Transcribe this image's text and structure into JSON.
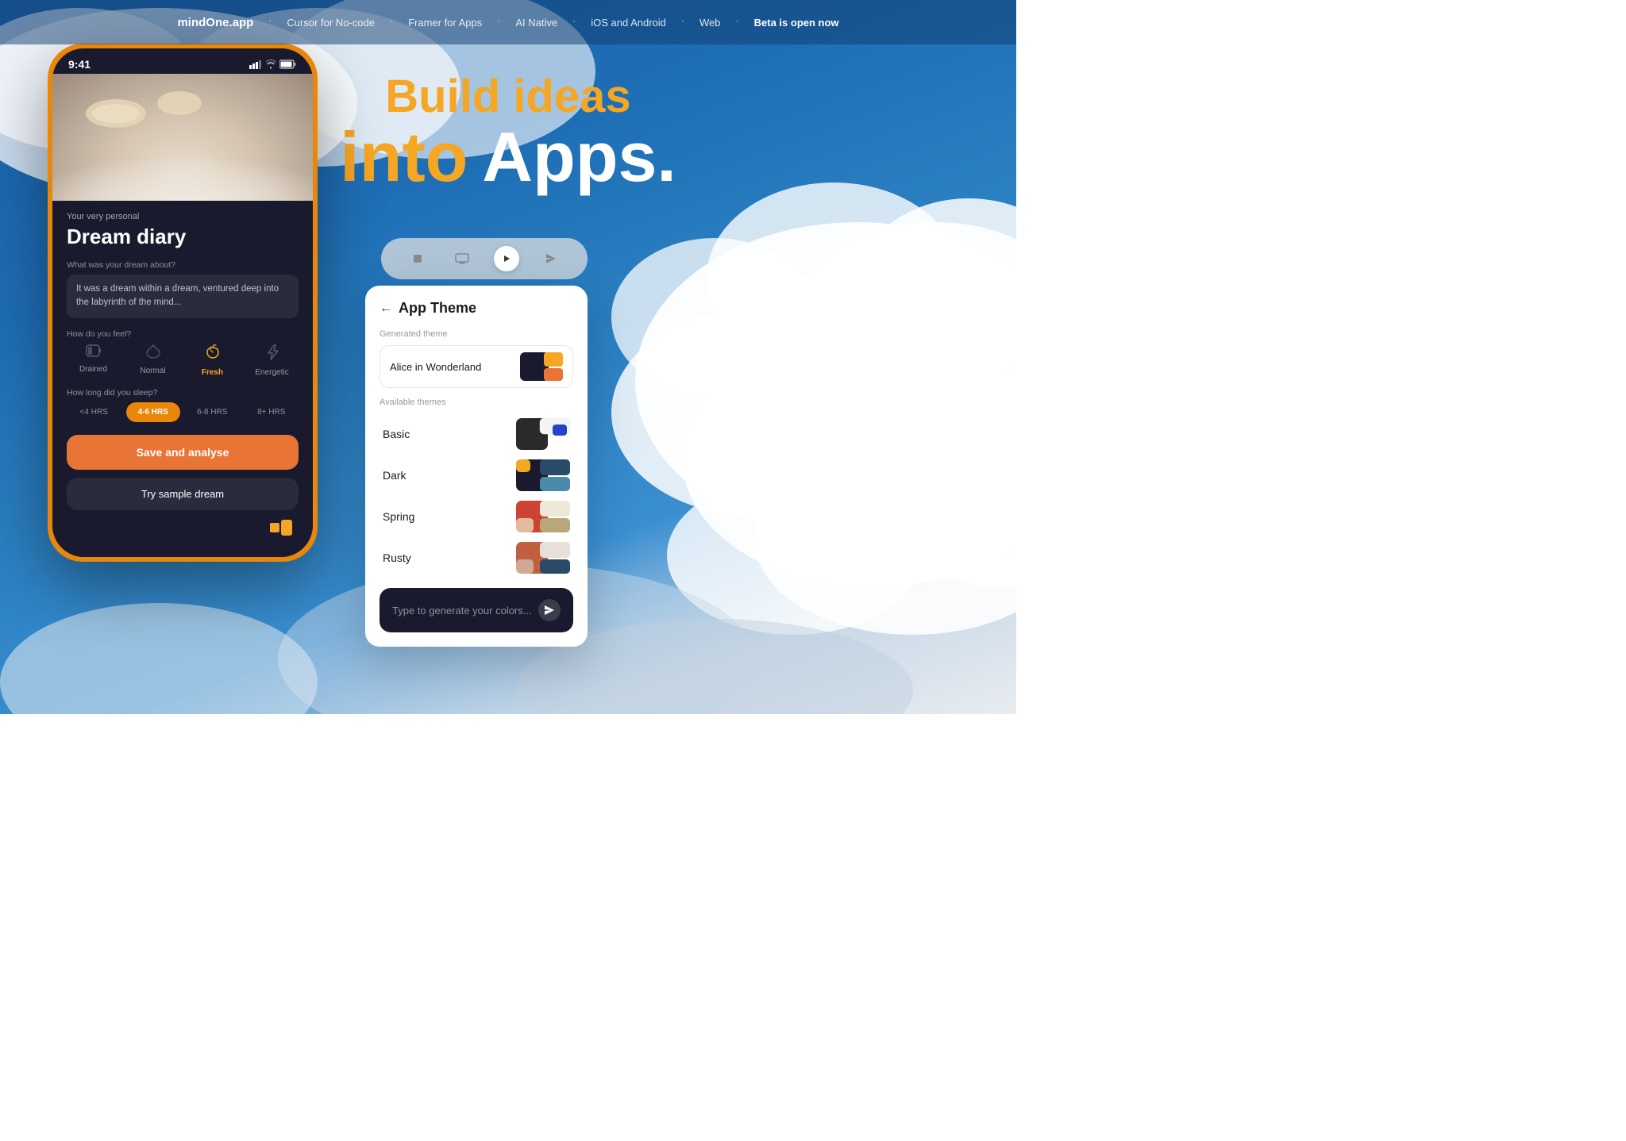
{
  "navbar": {
    "logo": "mindOne.app",
    "items": [
      {
        "label": "Cursor for No-code",
        "highlight": false
      },
      {
        "label": "Framer for Apps",
        "highlight": false
      },
      {
        "label": "AI Native",
        "highlight": false
      },
      {
        "label": "iOS and Android",
        "highlight": false
      },
      {
        "label": "Web",
        "highlight": false
      },
      {
        "label": "Beta is open now",
        "highlight": true
      }
    ],
    "dot": "•"
  },
  "hero": {
    "line1": "Build ideas",
    "line2_orange": "into",
    "line2_white": "Apps."
  },
  "phone": {
    "time": "9:41",
    "subtitle": "Your very personal",
    "title": "Dream diary",
    "dream_label": "What was your dream about?",
    "dream_text": "It was a dream within a dream, ventured deep into the labyrinth of the mind...",
    "feel_label": "How do you feel?",
    "feel_options": [
      {
        "label": "Drained",
        "icon": "🔋",
        "active": false
      },
      {
        "label": "Normal",
        "icon": "🌿",
        "active": false
      },
      {
        "label": "Fresh",
        "icon": "🍃",
        "active": true
      },
      {
        "label": "Energetic",
        "icon": "⚡",
        "active": false
      }
    ],
    "sleep_label": "How long did you sleep?",
    "sleep_options": [
      {
        "label": "<4 HRS",
        "active": false
      },
      {
        "label": "4-6 HRS",
        "active": true
      },
      {
        "label": "6-8 HRS",
        "active": false
      },
      {
        "label": "8+ HRS",
        "active": false
      }
    ],
    "save_btn": "Save and analyse",
    "sample_btn": "Try sample dream"
  },
  "theme_panel": {
    "back_label": "App Theme",
    "generated_label": "Generated theme",
    "generated_theme_name": "Alice in Wonderland",
    "available_label": "Available themes",
    "themes": [
      {
        "name": "Basic",
        "colors": [
          "#2a2a2a",
          "#2244cc",
          "#f5f5f5"
        ]
      },
      {
        "name": "Dark",
        "colors": [
          "#f5a623",
          "#2a4a6a",
          "#4a7a9a"
        ]
      },
      {
        "name": "Spring",
        "colors": [
          "#cc4433",
          "#b8a878",
          "#ede8d8"
        ]
      },
      {
        "name": "Rusty",
        "colors": [
          "#c06040",
          "#2a4a6a",
          "#e8e0d8"
        ]
      }
    ],
    "input_placeholder": "Type to generate your colors...",
    "toolbar": {
      "stop_icon": "■",
      "screen_icon": "🖥",
      "play_icon": "▶",
      "send_icon": "✈"
    }
  }
}
